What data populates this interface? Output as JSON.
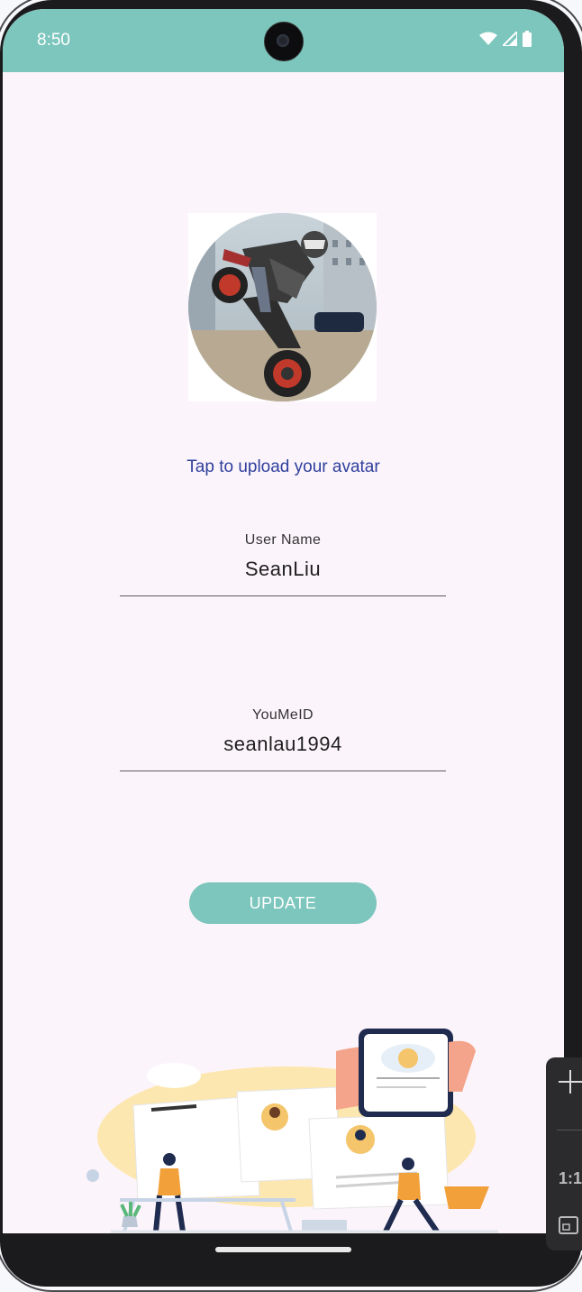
{
  "statusbar": {
    "time": "8:50"
  },
  "profile": {
    "tap_hint": "Tap to upload your avatar",
    "username_label": "User Name",
    "username_value": "SeanLiu",
    "id_label": "YouMeID",
    "id_value": "seanlau1994",
    "update_label": "UPDATE"
  },
  "emulator_panel": {
    "ratio_label": "1:1"
  },
  "colors": {
    "accent": "#7cc6bd",
    "link": "#2f3f9c",
    "background": "#fcf4fb"
  }
}
